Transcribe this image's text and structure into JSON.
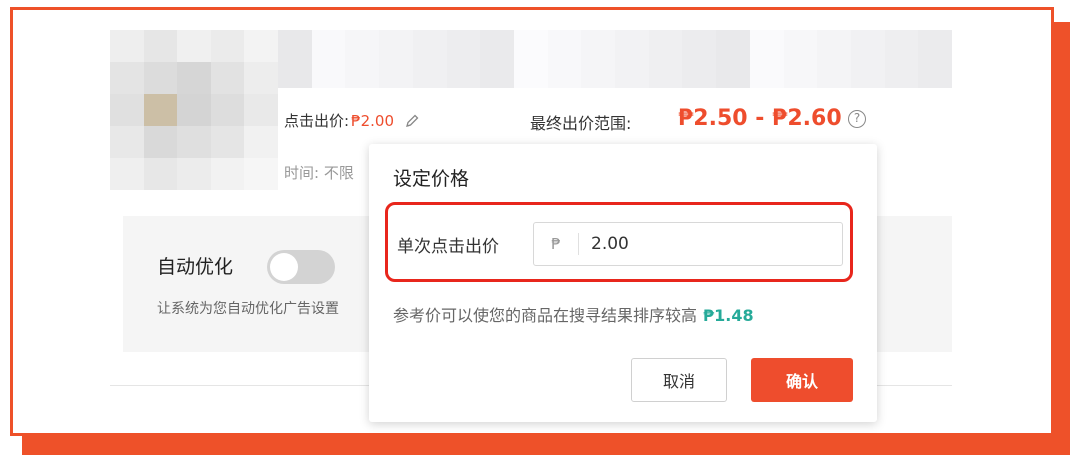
{
  "product": {
    "bid_label": "点击出价:",
    "bid_value": "₱2.00",
    "range_label": "最终出价范围:",
    "range_value": "₱2.50 - ₱2.60",
    "help_glyph": "?",
    "time_label": "时间: 不限"
  },
  "auto_optimize": {
    "title": "自动优化",
    "enabled": false,
    "description": "让系统为您自动优化广告设置"
  },
  "popover": {
    "title": "设定价格",
    "field_label": "单次点击出价",
    "currency_symbol": "₱",
    "field_value": "2.00",
    "reference_text": "参考价可以使您的商品在搜寻结果排序较高",
    "reference_price": "₱1.48",
    "cancel_label": "取消",
    "confirm_label": "确认"
  },
  "colors": {
    "accent": "#ee4d2d",
    "highlight": "#e8261c",
    "reference_price": "#26aa99",
    "frame": "#ee5129"
  }
}
